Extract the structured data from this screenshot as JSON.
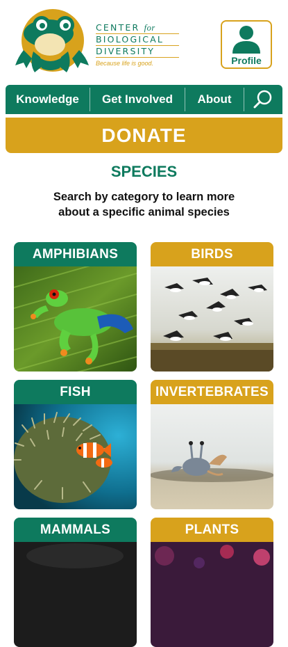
{
  "logo": {
    "line1": "CENTER",
    "line1_for": "for",
    "line2": "BIOLOGICAL",
    "line3": "DIVERSITY",
    "tagline": "Because life is good."
  },
  "profile": {
    "label": "Profile",
    "icon": "person-icon"
  },
  "nav": {
    "items": [
      {
        "label": "Knowledge"
      },
      {
        "label": "Get Involved"
      },
      {
        "label": "About"
      }
    ],
    "search_icon": "search-icon"
  },
  "donate": {
    "label": "DONATE"
  },
  "page": {
    "title": "SPECIES",
    "subtitle": "Search by category to learn more about a specific animal species"
  },
  "categories": [
    {
      "label": "AMPHIBIANS"
    },
    {
      "label": "BIRDS"
    },
    {
      "label": "FISH"
    },
    {
      "label": "INVERTEBRATES"
    },
    {
      "label": "MAMMALS"
    },
    {
      "label": "PLANTS"
    }
  ],
  "colors": {
    "brand_green": "#0e7a5e",
    "brand_gold": "#d8a21c"
  }
}
